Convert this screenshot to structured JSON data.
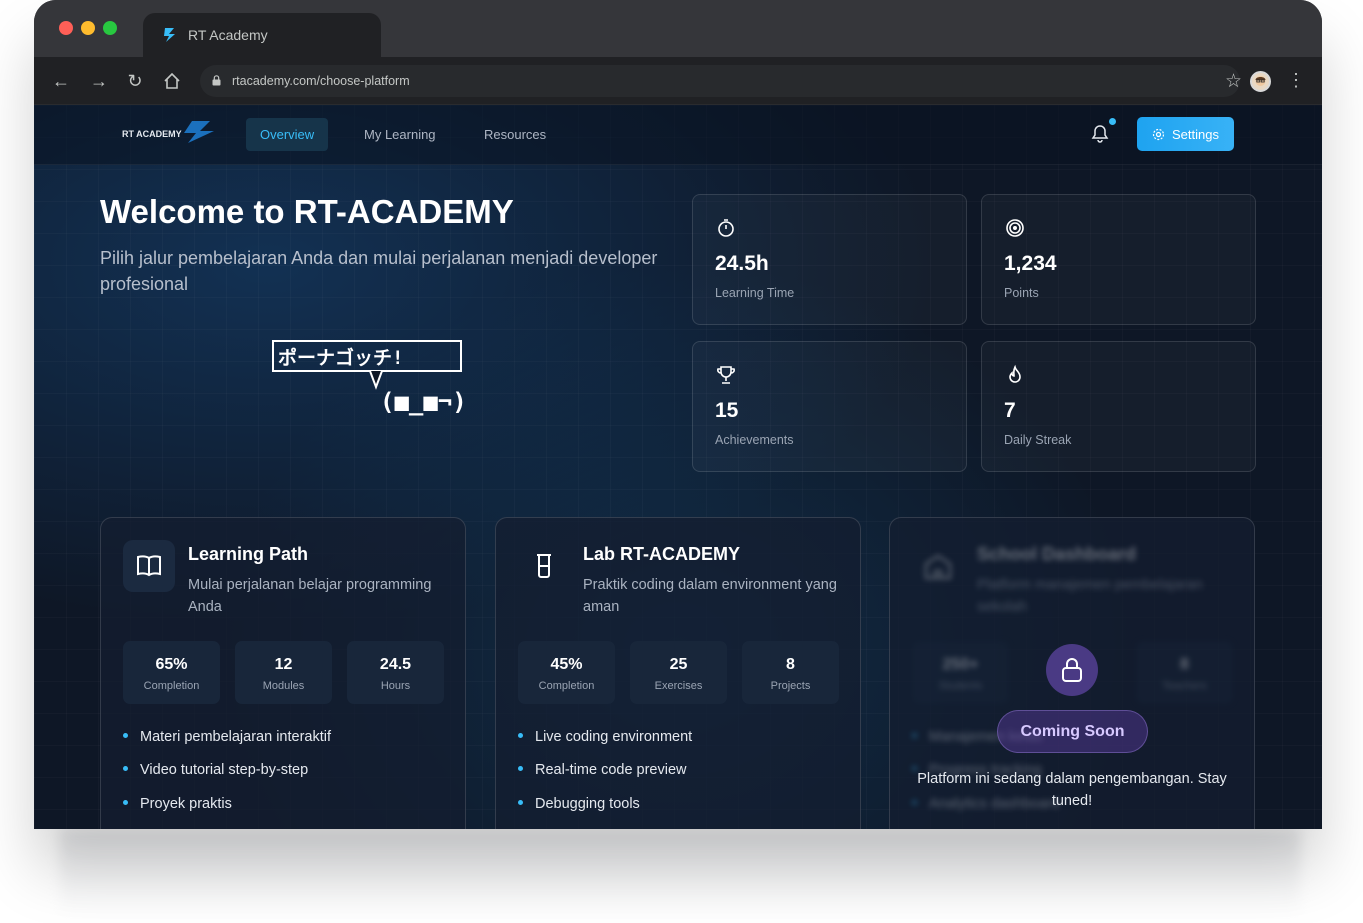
{
  "browser": {
    "tab_title": "RT Academy",
    "url": "rtacademy.com/choose-platform"
  },
  "nav": {
    "logo_text": "RT ACADEMY",
    "links": [
      "Overview",
      "My Learning",
      "Resources"
    ],
    "active": "Overview",
    "settings_label": "Settings"
  },
  "hero": {
    "title": "Welcome to RT-ACADEMY",
    "subtitle": "Pilih jalur pembelajaran Anda dan mulai perjalanan menjadi developer profesional",
    "kaomoji_top": "ポーナゴッチ!",
    "kaomoji_face": "(■_■¬)"
  },
  "stats": [
    {
      "icon": "stopwatch-icon",
      "value": "24.5h",
      "label": "Learning Time"
    },
    {
      "icon": "target-icon",
      "value": "1,234",
      "label": "Points"
    },
    {
      "icon": "trophy-icon",
      "value": "15",
      "label": "Achievements"
    },
    {
      "icon": "flame-icon",
      "value": "7",
      "label": "Daily Streak"
    }
  ],
  "cards": [
    {
      "icon": "book-icon",
      "title": "Learning Path",
      "desc": "Mulai perjalanan belajar programming Anda",
      "metrics": [
        {
          "value": "65%",
          "label": "Completion"
        },
        {
          "value": "12",
          "label": "Modules"
        },
        {
          "value": "24.5",
          "label": "Hours"
        }
      ],
      "features": [
        "Materi pembelajaran interaktif",
        "Video tutorial step-by-step",
        "Proyek praktis"
      ]
    },
    {
      "icon": "beaker-icon",
      "title": "Lab RT-ACADEMY",
      "desc": "Praktik coding dalam environment yang aman",
      "metrics": [
        {
          "value": "45%",
          "label": "Completion"
        },
        {
          "value": "25",
          "label": "Exercises"
        },
        {
          "value": "8",
          "label": "Projects"
        }
      ],
      "features": [
        "Live coding environment",
        "Real-time code preview",
        "Debugging tools"
      ]
    },
    {
      "icon": "school-icon",
      "title": "School Dashboard",
      "desc": "Platform manajemen pembelajaran sekolah",
      "metrics": [
        {
          "value": "250+",
          "label": "Students"
        },
        {
          "value": "",
          "label": ""
        },
        {
          "value": "8",
          "label": "Teachers"
        }
      ],
      "features": [
        "Manajemen kelas",
        "Progress tracking",
        "Analytics dashboard"
      ],
      "locked": true,
      "badge": "Coming Soon",
      "message": "Platform ini sedang dalam pengembangan. Stay tuned!"
    }
  ],
  "colors": {
    "accent": "#38bdf8",
    "background": "#0e1726",
    "locked_badge": "#4a3a84"
  }
}
